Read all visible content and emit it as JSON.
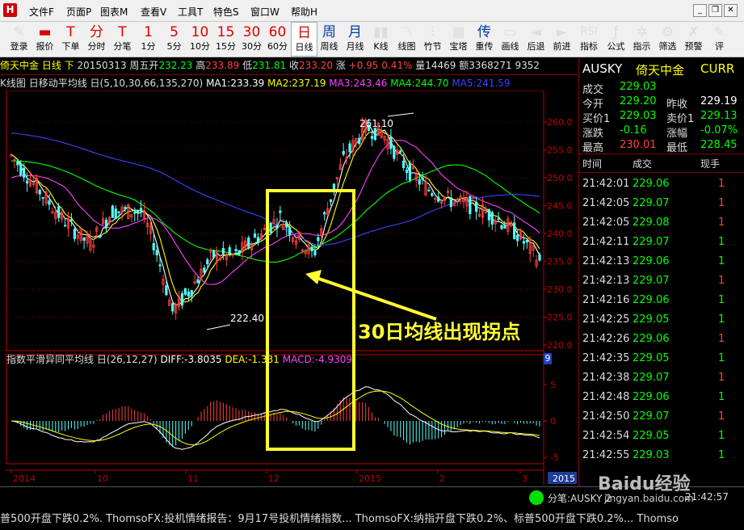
{
  "menu": {
    "items": [
      "文件F",
      "页面P",
      "图表M",
      "查看V",
      "工具T",
      "特色S",
      "窗口W",
      "帮助H"
    ]
  },
  "toolbar": {
    "buttons": [
      {
        "icon": "✎",
        "label": "登录"
      },
      {
        "icon": "▬",
        "label": "报价"
      },
      {
        "icon": "T",
        "label": "下单"
      },
      {
        "icon": "分",
        "label": "分时"
      },
      {
        "icon": "T",
        "label": "分笔"
      },
      {
        "icon": "1",
        "label": "1分"
      },
      {
        "icon": "5",
        "label": "5分"
      },
      {
        "icon": "10",
        "label": "10分"
      },
      {
        "icon": "15",
        "label": "15分"
      },
      {
        "icon": "30",
        "label": "30分"
      },
      {
        "icon": "60",
        "label": "60分"
      },
      {
        "icon": "日",
        "label": "日线"
      },
      {
        "icon": "周",
        "label": "周线"
      },
      {
        "icon": "月",
        "label": "月线"
      },
      {
        "icon": "▮▮",
        "label": "K线"
      },
      {
        "icon": "〽",
        "label": "线图"
      },
      {
        "icon": "⫶",
        "label": "竹节"
      },
      {
        "icon": "▦",
        "label": "宝塔"
      },
      {
        "icon": "传",
        "label": "重传"
      },
      {
        "icon": "▭",
        "label": "画线"
      },
      {
        "icon": "◄",
        "label": "后退"
      },
      {
        "icon": "►",
        "label": "前进"
      },
      {
        "icon": "RSI",
        "label": "指标"
      },
      {
        "icon": "ƒ",
        "label": "公式"
      },
      {
        "icon": "✲",
        "label": "指示"
      },
      {
        "icon": "⚙",
        "label": "筛选"
      },
      {
        "icon": "✗",
        "label": "预警"
      },
      {
        "icon": "✎",
        "label": "评"
      }
    ]
  },
  "info": {
    "name": "倚天中金",
    "period": "日线 下",
    "date": "20150313",
    "weekday": "周五",
    "open_label": "开",
    "open": "232.23",
    "high_label": "高",
    "high": "233.89",
    "low_label": "低",
    "low": "231.81",
    "close_label": "收",
    "close": "233.20",
    "change_label": "涨",
    "change": "+0.95",
    "change_pct": "0.41%",
    "vol_label": "量",
    "vol": "14469",
    "amount_label": "额",
    "amount": "3368271 9352"
  },
  "ma": {
    "title": "K线图",
    "indicator": "日移动平均线",
    "params": "日(5,10,30,66,135,270)",
    "ma1": "MA1:233.39",
    "ma2": "MA2:237.19",
    "ma3": "MA3:243.46",
    "ma4": "MA4:244.70",
    "ma5": "MA5:241.59"
  },
  "macd": {
    "title": "指数平滑异同平均线",
    "params": "日(26,12,27)",
    "diff": "DIFF:-3.8035",
    "dea": "DEA:-1.33",
    "dea_tail": "1",
    "macd": "MACD:-4.9309",
    "corner": "9"
  },
  "chart_annotations": {
    "high_label": "261.10",
    "low_label": "222.40",
    "callout": "30日均线出现拐点"
  },
  "axes": {
    "price_ticks": [
      "260.0",
      "255.0",
      "250.0",
      "245.0",
      "240.0",
      "235.0",
      "230.0",
      "225.0",
      "220.0"
    ],
    "macd_ticks": [
      "5",
      "0",
      "-5"
    ],
    "date_ticks": [
      "2014",
      "10",
      "11",
      "12",
      "2015",
      "2",
      "3"
    ],
    "corner_year": "2015"
  },
  "colors": {
    "up": "#ff4040",
    "down": "#54ffff",
    "ma1": "#ffffff",
    "ma2": "#ffff00",
    "ma3": "#ff40ff",
    "ma4": "#00ff00",
    "ma5": "#4040ff",
    "highlight": "#ffff33",
    "axis": "#c00000"
  },
  "quote": {
    "symbol": "AUSKY",
    "name": "倚天中金",
    "currency": "CURR",
    "rows": [
      {
        "l": "成交",
        "v": "229.03",
        "vc": "#00ff00"
      },
      {
        "l": "今开",
        "v": "229.20",
        "vc": "#00ff00",
        "l2": "昨收",
        "v2": "229.19",
        "v2c": "#ffffff"
      },
      {
        "l": "买价1",
        "v": "229.03",
        "vc": "#00ff00",
        "l2": "卖价1",
        "v2": "229.13",
        "v2c": "#00ff00"
      },
      {
        "l": "涨跌",
        "v": "-0.16",
        "vc": "#00ff00",
        "l2": "涨幅",
        "v2": "-0.07%",
        "v2c": "#00ff00"
      },
      {
        "l": "最高",
        "v": "230.01",
        "vc": "#ff4040",
        "l2": "最低",
        "v2": "228.45",
        "v2c": "#00ff00"
      }
    ],
    "headers": [
      "时间",
      "成交",
      "现手"
    ],
    "ticks": [
      {
        "t": "21:42:01",
        "p": "229.06",
        "pc": "#00ff00",
        "q": "1",
        "qc": "#ff4040"
      },
      {
        "t": "21:42:05",
        "p": "229.07",
        "pc": "#00ff00",
        "q": "1",
        "qc": "#ff4040"
      },
      {
        "t": "21:42:05",
        "p": "229.08",
        "pc": "#00ff00",
        "q": "1",
        "qc": "#ff4040"
      },
      {
        "t": "21:42:11",
        "p": "229.07",
        "pc": "#00ff00",
        "q": "1",
        "qc": "#00ff00"
      },
      {
        "t": "21:42:13",
        "p": "229.06",
        "pc": "#00ff00",
        "q": "1",
        "qc": "#00ff00"
      },
      {
        "t": "21:42:13",
        "p": "229.07",
        "pc": "#00ff00",
        "q": "1",
        "qc": "#ff4040"
      },
      {
        "t": "21:42:16",
        "p": "229.06",
        "pc": "#00ff00",
        "q": "1",
        "qc": "#00ff00"
      },
      {
        "t": "21:42:25",
        "p": "229.05",
        "pc": "#00ff00",
        "q": "1",
        "qc": "#00ff00"
      },
      {
        "t": "21:42:26",
        "p": "229.06",
        "pc": "#00ff00",
        "q": "1",
        "qc": "#ff4040"
      },
      {
        "t": "21:42:35",
        "p": "229.05",
        "pc": "#00ff00",
        "q": "1",
        "qc": "#00ff00"
      },
      {
        "t": "21:42:38",
        "p": "229.07",
        "pc": "#00ff00",
        "q": "1",
        "qc": "#ff4040"
      },
      {
        "t": "21:42:48",
        "p": "229.06",
        "pc": "#00ff00",
        "q": "1",
        "qc": "#00ff00"
      },
      {
        "t": "21:42:50",
        "p": "229.07",
        "pc": "#00ff00",
        "q": "1",
        "qc": "#ff4040"
      },
      {
        "t": "21:42:54",
        "p": "229.05",
        "pc": "#00ff00",
        "q": "1",
        "qc": "#00ff00"
      },
      {
        "t": "21:42:55",
        "p": "229.03",
        "pc": "#00ff00",
        "q": "1",
        "qc": "#00ff00"
      }
    ]
  },
  "statusbar": {
    "label": "分笔:AUSKY 2",
    "time": "21:42:57",
    "watermark_logo": "Baidu经验",
    "watermark_url": "jingyan.baidu.com"
  },
  "ticker": {
    "text": "普500开盘下跌0.2%.    ThomsoFX:投机情绪报告：9月17号投机情绪指数...    ThomsoFX:纳指开盘下跌0.2%、标普500开盘下跌0.2%...    Thomso"
  }
}
